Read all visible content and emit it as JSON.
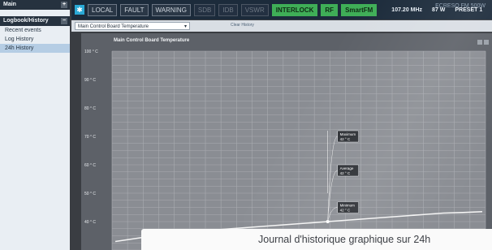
{
  "topbar": {
    "buttons": [
      "LOCAL",
      "FAULT",
      "WARNING",
      "SDB",
      "IDB",
      "VSWR",
      "INTERLOCK",
      "RF",
      "SmartFM"
    ],
    "frequency": "107.20 MHz",
    "power": "87 W",
    "preset": "PRESET 1",
    "brand": "ECRESO FM 500W"
  },
  "sidebar": {
    "main_label": "Main",
    "logbook_label": "Logbook/History",
    "items": [
      "Recent events",
      "Log History",
      "24h History"
    ],
    "active_index": 2
  },
  "controls": {
    "selected": "Main Control Board Temperature",
    "clear_history": "Clear History"
  },
  "chart_data": {
    "type": "line",
    "title": "Main Control Board Temperature",
    "ylim": [
      30,
      100
    ],
    "y_ticks": [
      "100 ° C",
      "90 ° C",
      "80 ° C",
      "70 ° C",
      "60 ° C",
      "50 ° C",
      "40 ° C"
    ],
    "series": [
      {
        "values": [
          33,
          34,
          35,
          36,
          36.5,
          37,
          37.5,
          38,
          38.5,
          39,
          39.5,
          40,
          40.5,
          41,
          41.5,
          42,
          42.5,
          43,
          43.2,
          43.5
        ]
      }
    ],
    "annotations": {
      "maximum_label": "Maximum",
      "maximum_value": "42 ° C",
      "average_label": "Average",
      "average_value": "42 ° C",
      "minimum_label": "Minimum",
      "minimum_value": "42 ° C"
    }
  },
  "caption": "Journal d'historique graphique sur 24h"
}
